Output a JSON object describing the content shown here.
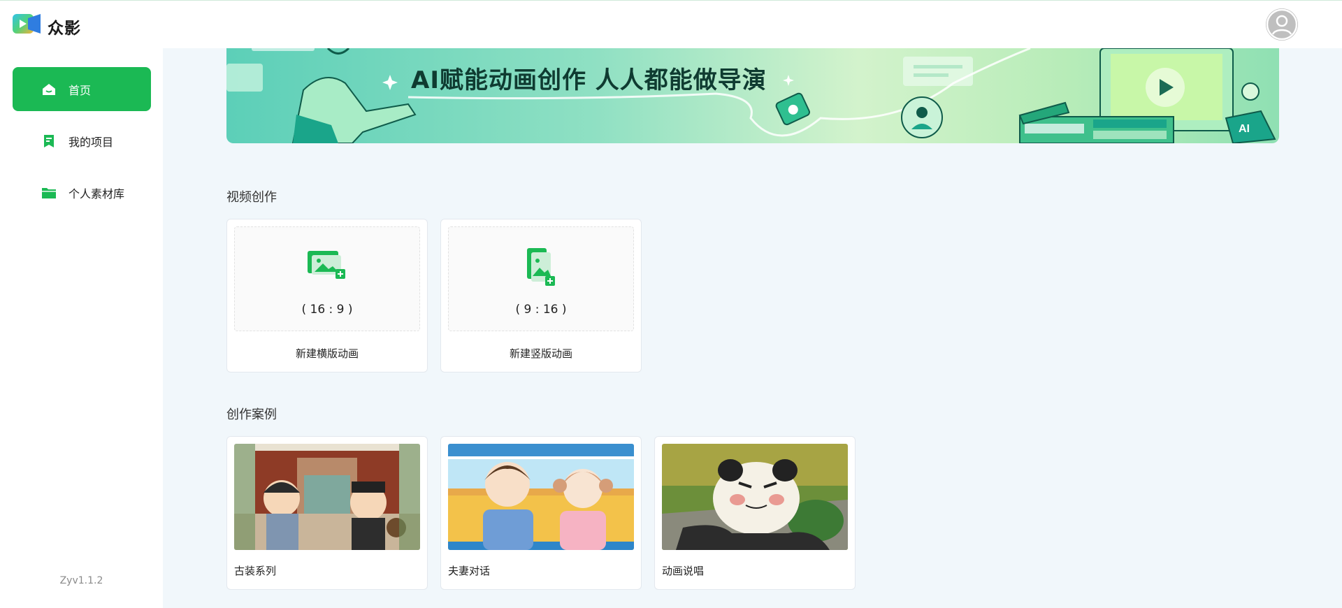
{
  "header": {
    "brand": "众影"
  },
  "sidebar": {
    "items": [
      {
        "label": "首页",
        "icon": "home-icon",
        "active": true
      },
      {
        "label": "我的项目",
        "icon": "bookmark-icon",
        "active": false
      },
      {
        "label": "个人素材库",
        "icon": "folder-icon",
        "active": false
      }
    ],
    "version": "Zyv1.1.2"
  },
  "banner": {
    "title": "AI赋能动画创作  人人都能做导演"
  },
  "video_creation": {
    "title": "视频创作",
    "cards": [
      {
        "ratio": "( 16 : 9 )",
        "label": "新建横版动画"
      },
      {
        "ratio": "( 9 : 16 )",
        "label": "新建竖版动画"
      }
    ]
  },
  "cases": {
    "title": "创作案例",
    "items": [
      {
        "label": "古装系列"
      },
      {
        "label": "夫妻对话"
      },
      {
        "label": "动画说唱"
      }
    ]
  },
  "colors": {
    "accent": "#1bb954",
    "background": "#f1f7fb"
  }
}
